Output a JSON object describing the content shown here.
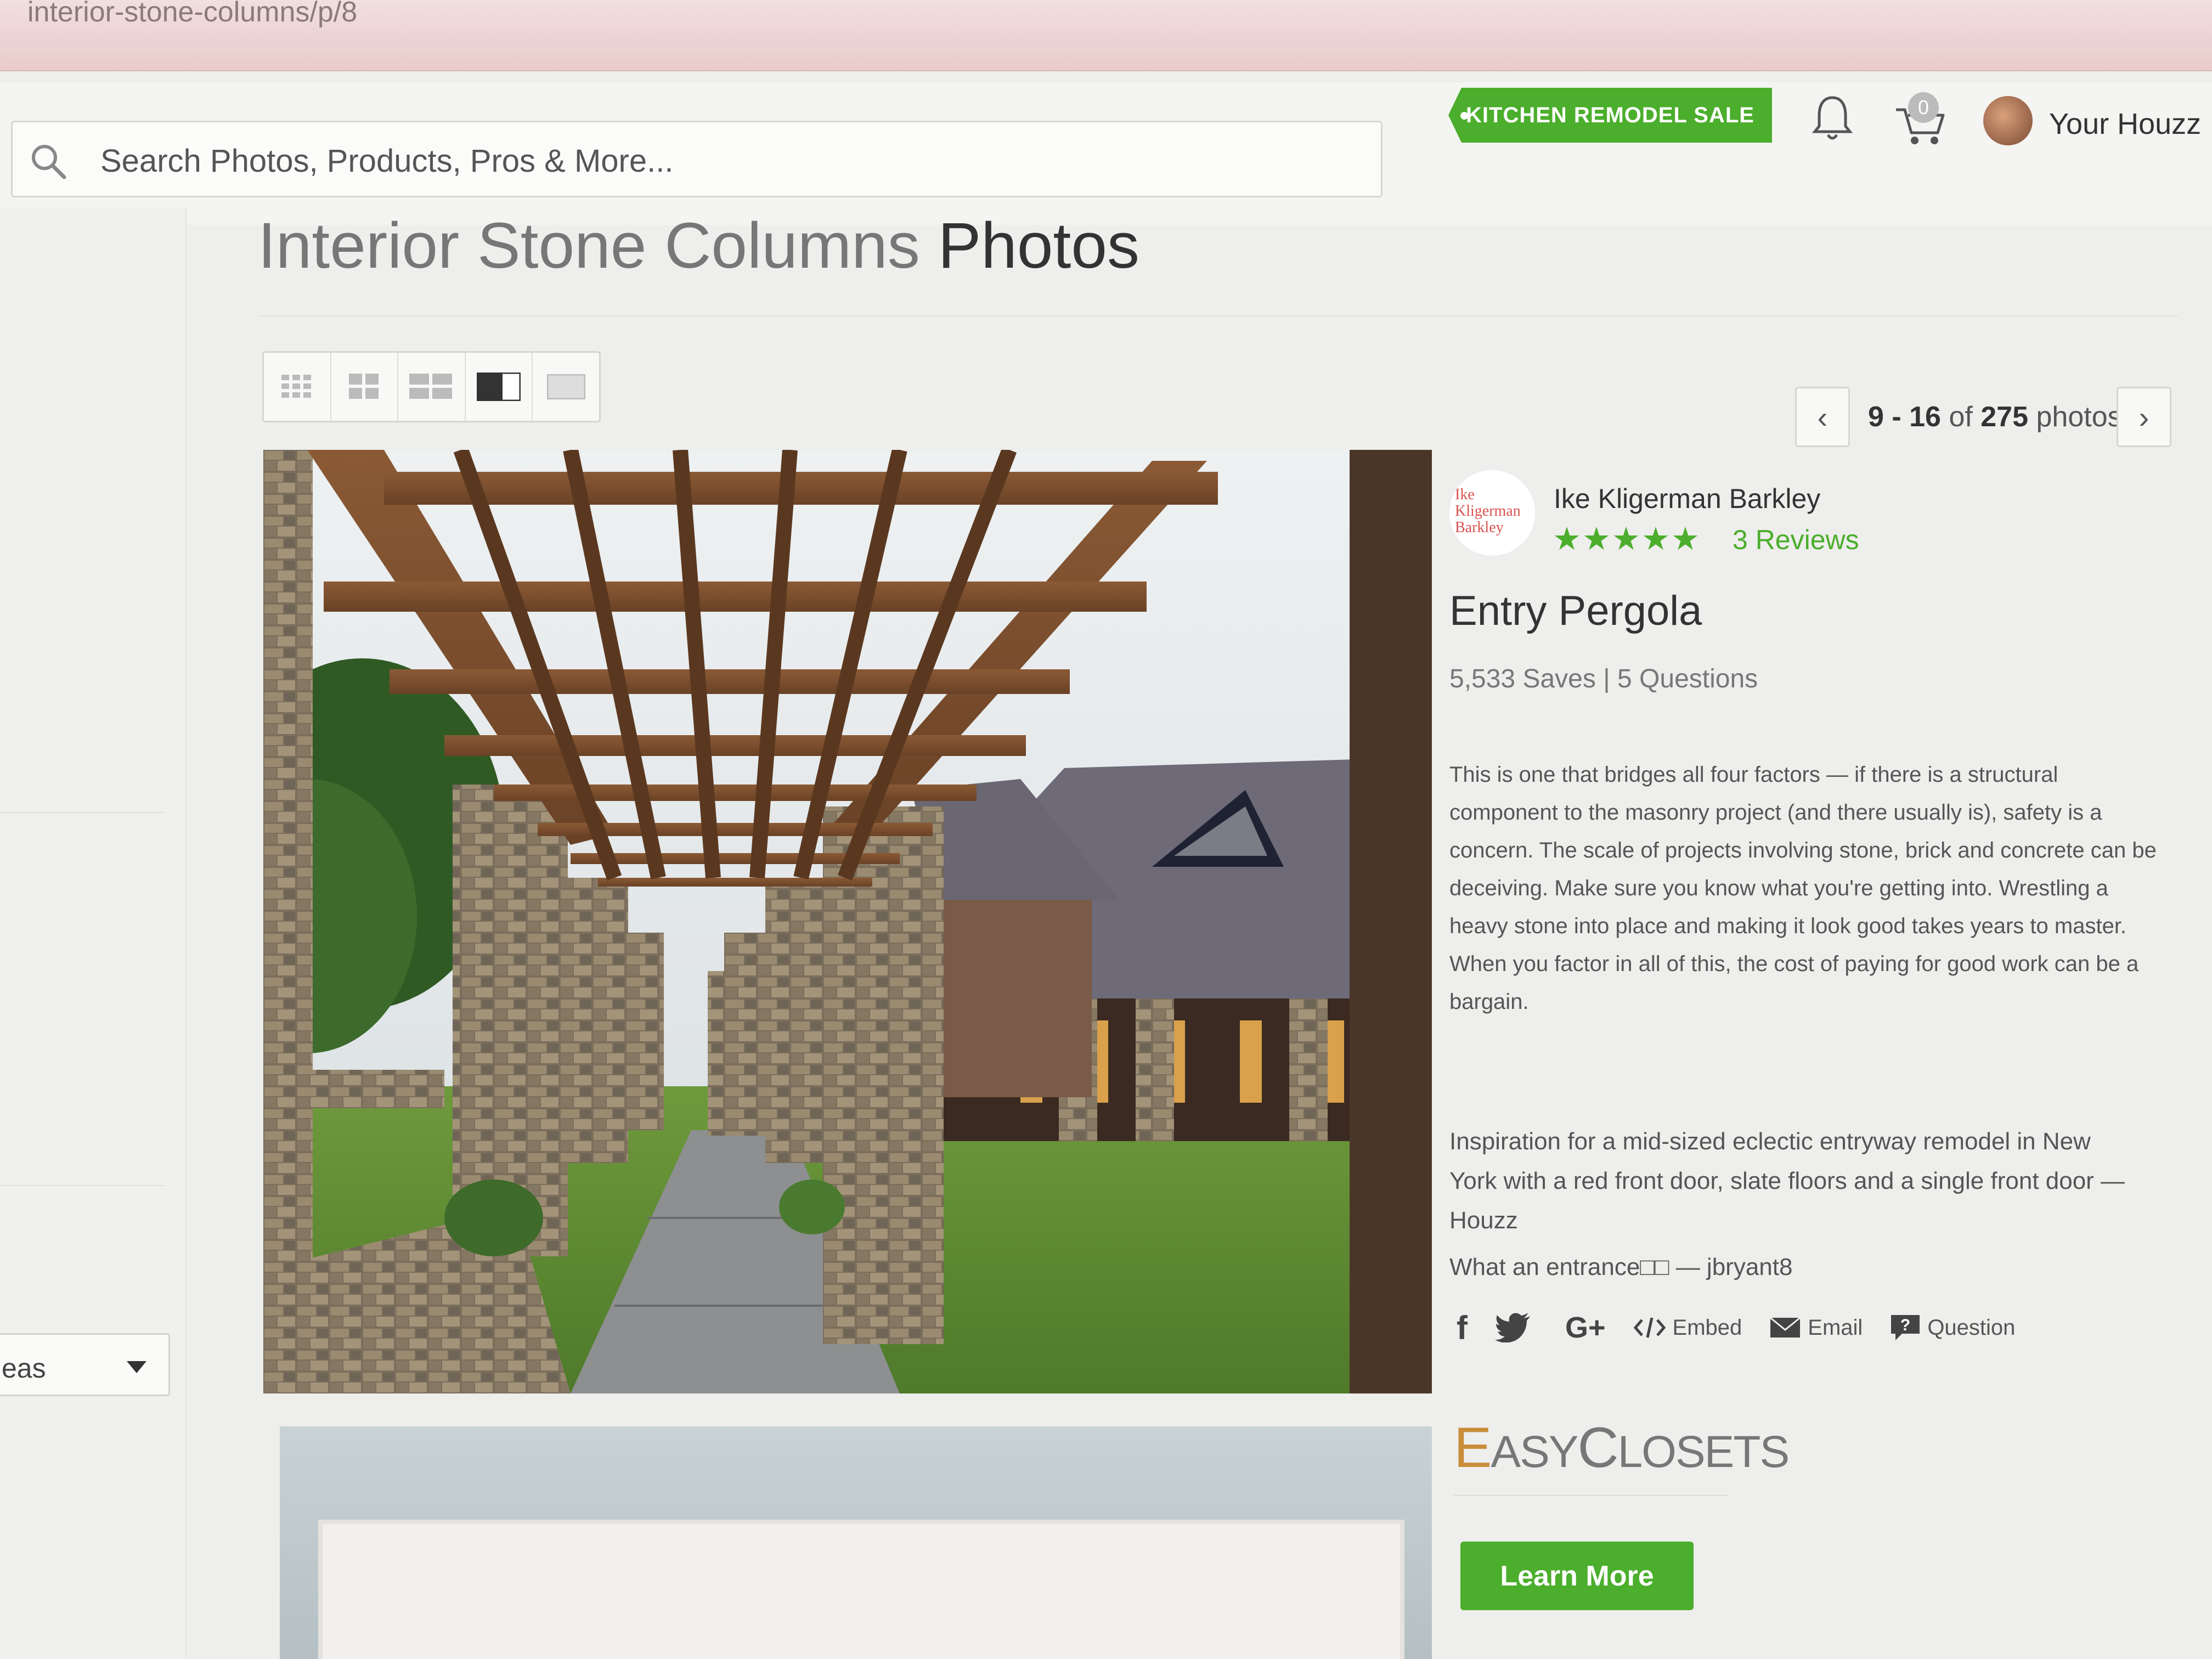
{
  "browser": {
    "url": "interior-stone-columns/p/8"
  },
  "header": {
    "search_placeholder": "Search Photos, Products, Pros & More...",
    "sale_label": "KITCHEN REMODEL SALE",
    "cart_count": "0",
    "your_houzz": "Your Houzz"
  },
  "page": {
    "title_light": "Interior Stone Columns",
    "title_strong": "Photos"
  },
  "pager": {
    "range": "9 - 16",
    "of": "of",
    "total": "275",
    "unit": "photos"
  },
  "sidebar": {
    "select_label": "eas"
  },
  "pro": {
    "logo_text": "Ike Kligerman Barkley",
    "name": "Ike Kligerman Barkley",
    "stars": "★★★★★",
    "reviews": "3 Reviews"
  },
  "photo": {
    "title": "Entry Pergola",
    "stats": "5,533 Saves | 5 Questions",
    "description": "This is one that bridges all four factors — if there is a structural component to the masonry project (and there usually is), safety is a concern. The scale of projects involving stone, brick and concrete can be deceiving. Make sure you know what you're getting into. Wrestling a heavy stone into place and making it look good takes years to master. When you factor in all of this, the cost of paying for good work can be a bargain.",
    "inspiration": "Inspiration for a mid-sized eclectic entryway remodel in New York with a red front door, slate floors and a single front door — Houzz",
    "comment": "What an entrance□□ — jbryant8"
  },
  "share": {
    "facebook": "f",
    "googleplus": "G+",
    "embed": "Embed",
    "email": "Email",
    "question": "Question"
  },
  "ad": {
    "logo_first": "E",
    "logo_rest1": "ASY",
    "logo_c": "C",
    "logo_rest2": "LOSETS",
    "button": "Learn More"
  },
  "colors": {
    "accent_green": "#4bae2c",
    "title_gray": "#777777"
  }
}
